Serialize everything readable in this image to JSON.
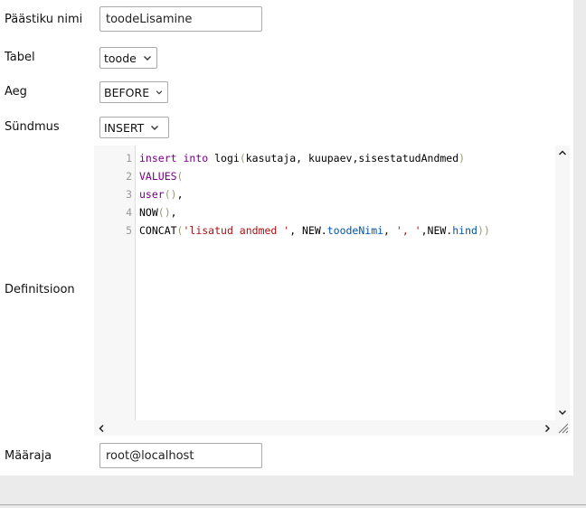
{
  "form": {
    "trigger_name": {
      "label": "Päästiku nimi",
      "value": "toodeLisamine"
    },
    "table": {
      "label": "Tabel",
      "value": "toode"
    },
    "time": {
      "label": "Aeg",
      "value": "BEFORE"
    },
    "event": {
      "label": "Sündmus",
      "value": "INSERT"
    },
    "definition": {
      "label": "Definitsioon",
      "line_numbers": [
        "1",
        "2",
        "3",
        "4",
        "5"
      ],
      "lines": [
        [
          {
            "t": "kw",
            "v": "insert"
          },
          {
            "t": "fn",
            "v": " "
          },
          {
            "t": "kw",
            "v": "into"
          },
          {
            "t": "fn",
            "v": " logi"
          },
          {
            "t": "paren",
            "v": "("
          },
          {
            "t": "fn",
            "v": "kasutaja, kuupaev,sisestatudAndmed"
          },
          {
            "t": "paren",
            "v": ")"
          }
        ],
        [
          {
            "t": "kw",
            "v": "VALUES"
          },
          {
            "t": "paren",
            "v": "("
          }
        ],
        [
          {
            "t": "kw",
            "v": "user"
          },
          {
            "t": "paren",
            "v": "()"
          },
          {
            "t": "fn",
            "v": ","
          }
        ],
        [
          {
            "t": "fn",
            "v": "NOW"
          },
          {
            "t": "paren",
            "v": "()"
          },
          {
            "t": "fn",
            "v": ","
          }
        ],
        [
          {
            "t": "fn",
            "v": "CONCAT"
          },
          {
            "t": "paren",
            "v": "("
          },
          {
            "t": "str",
            "v": "'lisatud andmed '"
          },
          {
            "t": "fn",
            "v": ", NEW."
          },
          {
            "t": "prop",
            "v": "toodeNimi"
          },
          {
            "t": "fn",
            "v": ", "
          },
          {
            "t": "str",
            "v": "', '"
          },
          {
            "t": "fn",
            "v": ",NEW."
          },
          {
            "t": "prop",
            "v": "hind"
          },
          {
            "t": "paren",
            "v": "))"
          }
        ]
      ]
    },
    "definer": {
      "label": "Määraja",
      "value": "root@localhost"
    }
  },
  "icons": {
    "dropdown": "chevron-down-icon",
    "scroll_up": "chevron-up-icon",
    "scroll_down": "chevron-down-icon",
    "scroll_left": "chevron-left-icon",
    "scroll_right": "chevron-right-icon",
    "resize": "resize-grip-icon"
  },
  "colors": {
    "keyword": "#770088",
    "string": "#aa1111",
    "property": "#0055aa",
    "line_number": "#999999"
  }
}
